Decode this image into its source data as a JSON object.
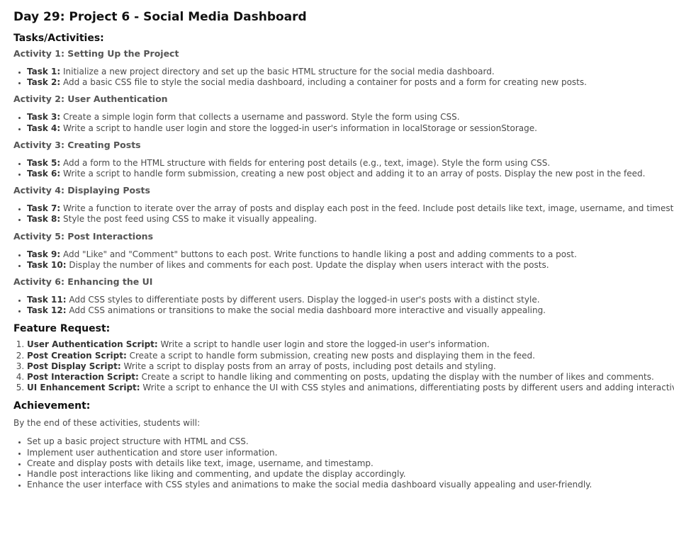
{
  "title": "Day 29: Project 6 - Social Media Dashboard",
  "tasks_heading": "Tasks/Activities:",
  "activities": [
    {
      "title": "Activity 1: Setting Up the Project",
      "tasks": [
        {
          "label": "Task 1:",
          "text": " Initialize a new project directory and set up the basic HTML structure for the social media dashboard."
        },
        {
          "label": "Task 2:",
          "text": " Add a basic CSS file to style the social media dashboard, including a container for posts and a form for creating new posts."
        }
      ]
    },
    {
      "title": "Activity 2: User Authentication",
      "tasks": [
        {
          "label": "Task 3:",
          "text": " Create a simple login form that collects a username and password. Style the form using CSS."
        },
        {
          "label": "Task 4:",
          "text": " Write a script to handle user login and store the logged-in user's information in localStorage or sessionStorage."
        }
      ]
    },
    {
      "title": "Activity 3: Creating Posts",
      "tasks": [
        {
          "label": "Task 5:",
          "text": " Add a form to the HTML structure with fields for entering post details (e.g., text, image). Style the form using CSS."
        },
        {
          "label": "Task 6:",
          "text": " Write a script to handle form submission, creating a new post object and adding it to an array of posts. Display the new post in the feed."
        }
      ]
    },
    {
      "title": "Activity 4: Displaying Posts",
      "tasks": [
        {
          "label": "Task 7:",
          "text": " Write a function to iterate over the array of posts and display each post in the feed. Include post details like text, image, username, and timestamp."
        },
        {
          "label": "Task 8:",
          "text": " Style the post feed using CSS to make it visually appealing."
        }
      ]
    },
    {
      "title": "Activity 5: Post Interactions",
      "tasks": [
        {
          "label": "Task 9:",
          "text": " Add \"Like\" and \"Comment\" buttons to each post. Write functions to handle liking a post and adding comments to a post."
        },
        {
          "label": "Task 10:",
          "text": " Display the number of likes and comments for each post. Update the display when users interact with the posts."
        }
      ]
    },
    {
      "title": "Activity 6: Enhancing the UI",
      "tasks": [
        {
          "label": "Task 11:",
          "text": " Add CSS styles to differentiate posts by different users. Display the logged-in user's posts with a distinct style."
        },
        {
          "label": "Task 12:",
          "text": " Add CSS animations or transitions to make the social media dashboard more interactive and visually appealing."
        }
      ]
    }
  ],
  "feature_heading": "Feature Request:",
  "features": [
    {
      "label": "User Authentication Script:",
      "text": " Write a script to handle user login and store the logged-in user's information."
    },
    {
      "label": "Post Creation Script:",
      "text": " Create a script to handle form submission, creating new posts and displaying them in the feed."
    },
    {
      "label": "Post Display Script:",
      "text": " Write a script to display posts from an array of posts, including post details and styling."
    },
    {
      "label": "Post Interaction Script:",
      "text": " Create a script to handle liking and commenting on posts, updating the display with the number of likes and comments."
    },
    {
      "label": "UI Enhancement Script:",
      "text": " Write a script to enhance the UI with CSS styles and animations, differentiating posts by different users and adding interactivity."
    }
  ],
  "achievement_heading": "Achievement:",
  "achievement_intro": "By the end of these activities, students will:",
  "achievements": [
    "Set up a basic project structure with HTML and CSS.",
    "Implement user authentication and store user information.",
    "Create and display posts with details like text, image, username, and timestamp.",
    "Handle post interactions like liking and commenting, and update the display accordingly.",
    "Enhance the user interface with CSS styles and animations to make the social media dashboard visually appealing and user-friendly."
  ]
}
